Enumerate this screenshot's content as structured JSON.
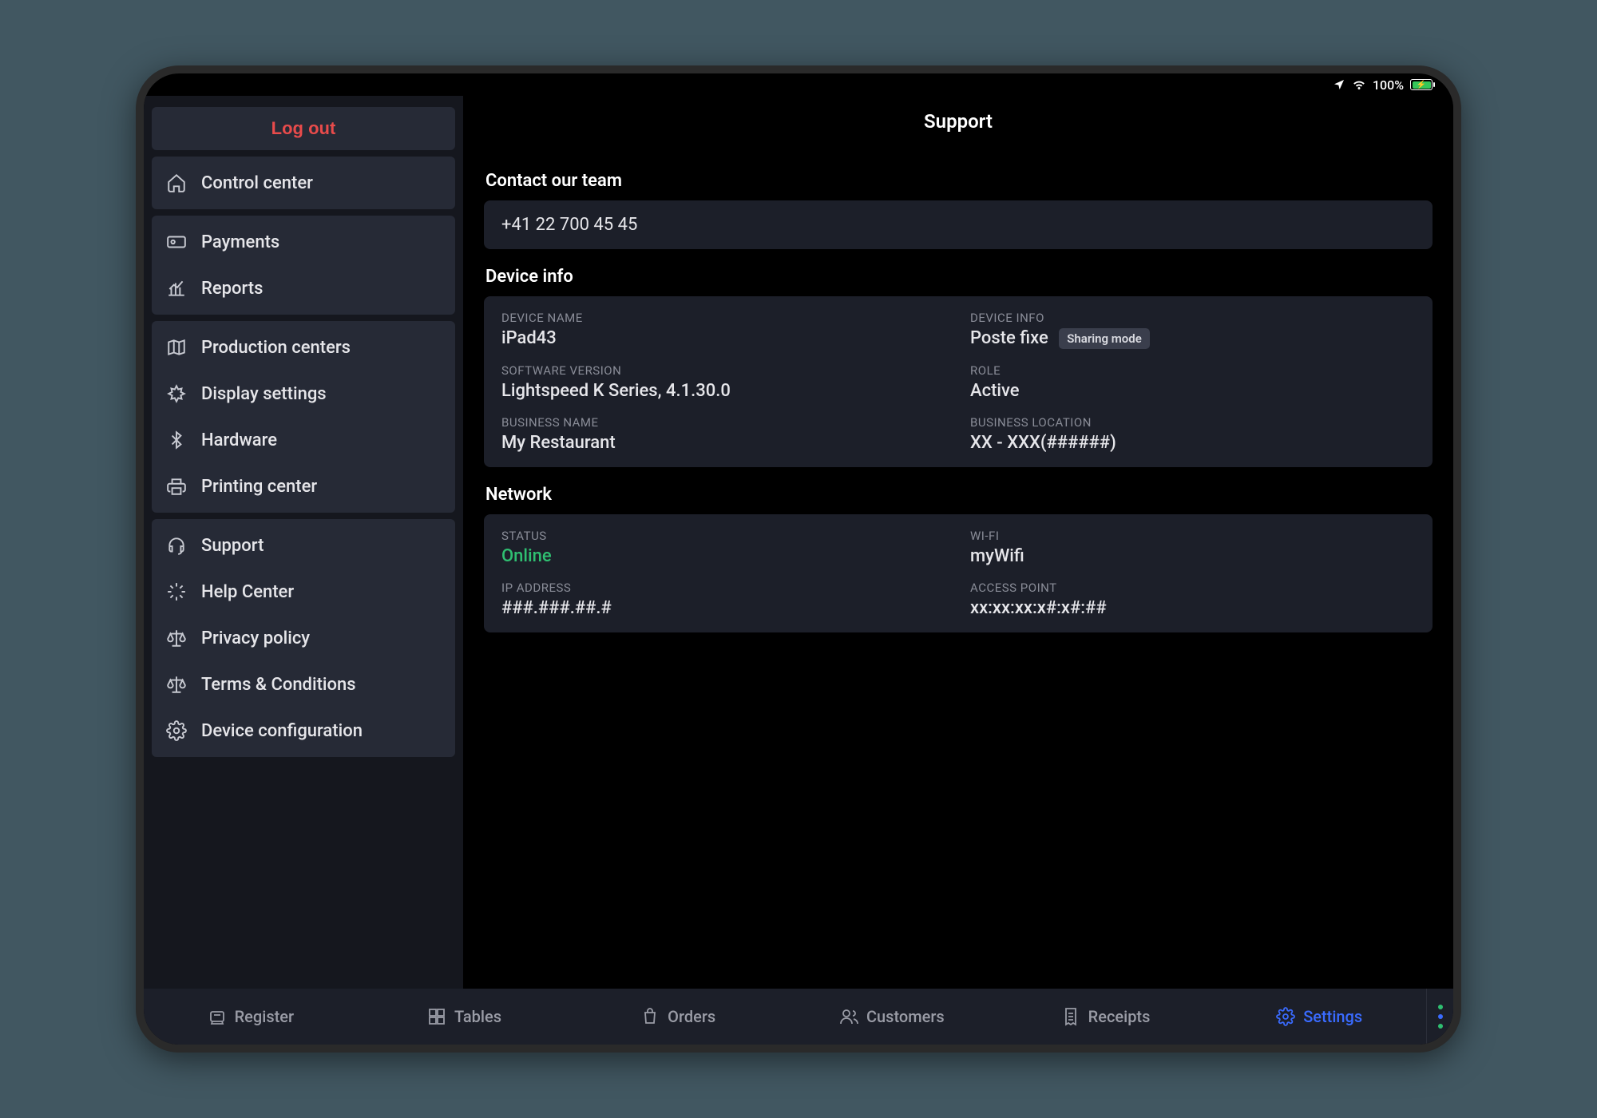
{
  "status_bar": {
    "battery_pct": "100%"
  },
  "sidebar": {
    "logout_label": "Log out",
    "groups": [
      {
        "items": [
          {
            "label": "Control center",
            "icon": "home"
          }
        ]
      },
      {
        "items": [
          {
            "label": "Payments",
            "icon": "card"
          },
          {
            "label": "Reports",
            "icon": "chart"
          }
        ]
      },
      {
        "items": [
          {
            "label": "Production centers",
            "icon": "map"
          },
          {
            "label": "Display settings",
            "icon": "display"
          },
          {
            "label": "Hardware",
            "icon": "bluetooth"
          },
          {
            "label": "Printing center",
            "icon": "printer"
          }
        ]
      },
      {
        "items": [
          {
            "label": "Support",
            "icon": "headset"
          },
          {
            "label": "Help Center",
            "icon": "spark"
          },
          {
            "label": "Privacy policy",
            "icon": "scale"
          },
          {
            "label": "Terms & Conditions",
            "icon": "scale"
          },
          {
            "label": "Device configuration",
            "icon": "gear"
          }
        ]
      }
    ]
  },
  "page": {
    "title": "Support",
    "contact_heading": "Contact our team",
    "contact_phone": "+41 22 700 45 45",
    "device_info_heading": "Device info",
    "device": {
      "device_name_label": "DEVICE NAME",
      "device_name": "iPad43",
      "device_info_label": "DEVICE INFO",
      "device_info": "Poste fixe",
      "device_info_badge": "Sharing mode",
      "software_label": "SOFTWARE VERSION",
      "software": "Lightspeed K Series, 4.1.30.0",
      "role_label": "ROLE",
      "role": "Active",
      "business_name_label": "BUSINESS NAME",
      "business_name": "My Restaurant",
      "business_location_label": "BUSINESS LOCATION",
      "business_location": "XX - XXX(######)"
    },
    "network_heading": "Network",
    "network": {
      "status_label": "STATUS",
      "status": "Online",
      "wifi_label": "WI-FI",
      "wifi": "myWifi",
      "ip_label": "IP ADDRESS",
      "ip": "###.###.##.#",
      "ap_label": "ACCESS POINT",
      "ap": "xx:xx:xx:x#:x#:##"
    }
  },
  "tabs": {
    "register": "Register",
    "tables": "Tables",
    "orders": "Orders",
    "customers": "Customers",
    "receipts": "Receipts",
    "settings": "Settings"
  }
}
